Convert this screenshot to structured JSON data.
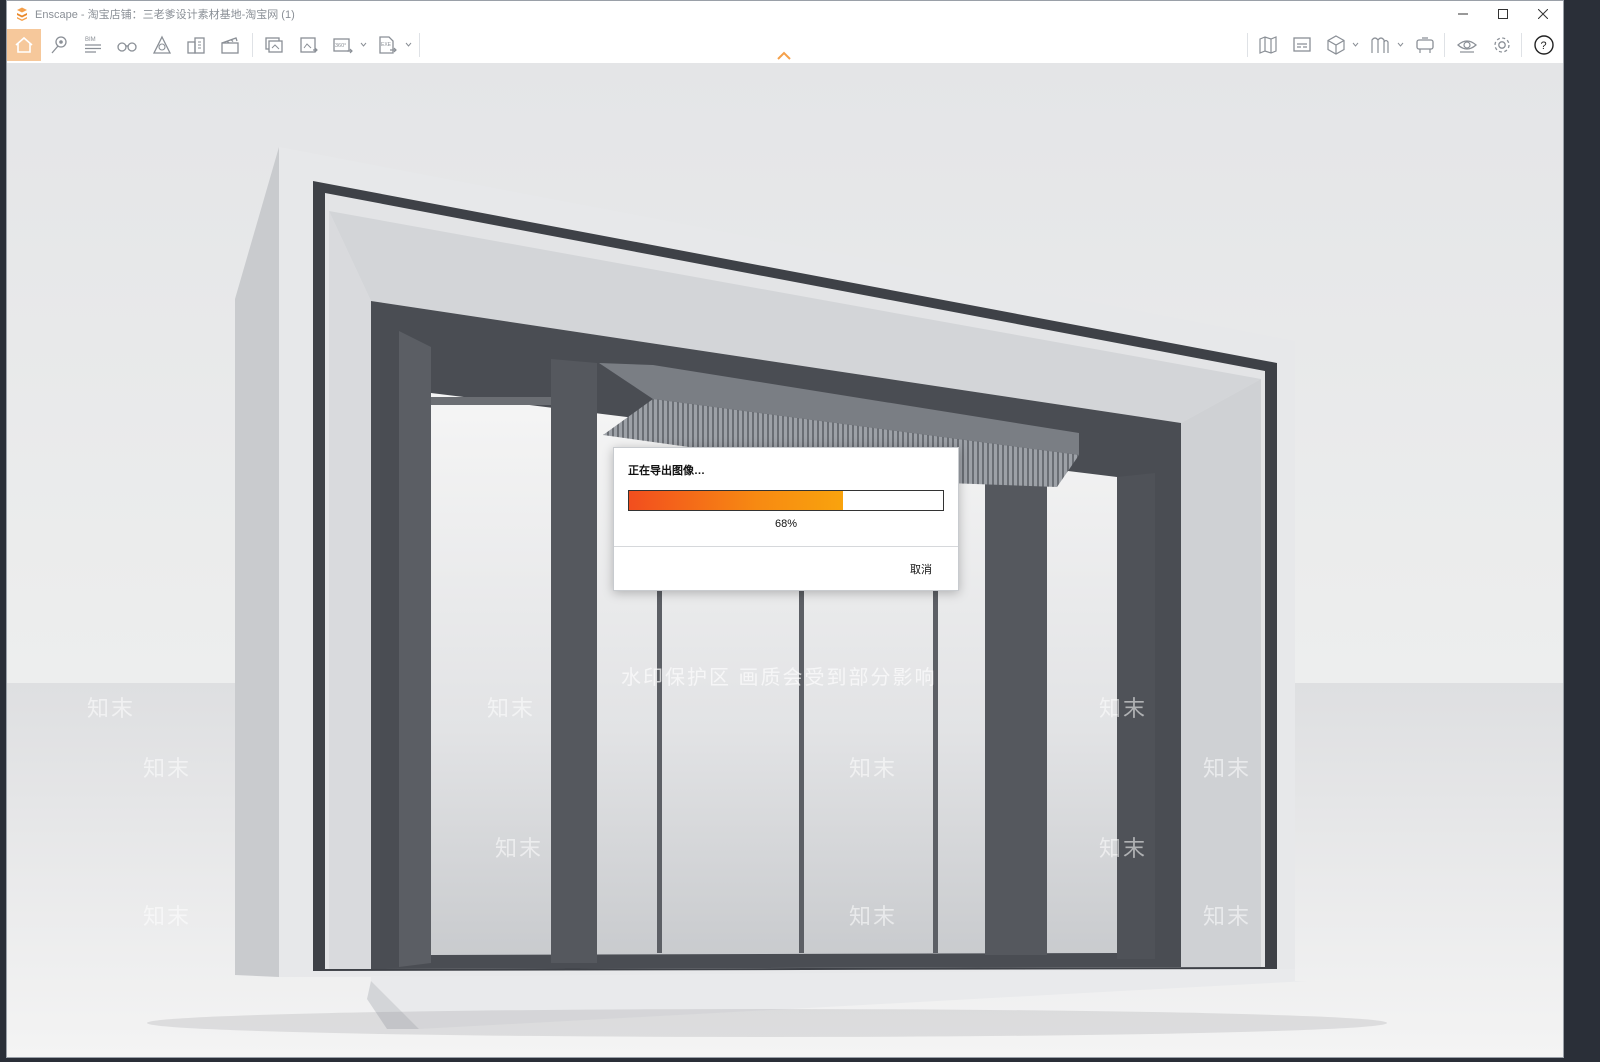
{
  "window": {
    "app_name": "Enscape",
    "title": "Enscape - 淘宝店铺：三老爹设计素材基地-淘宝网 (1)",
    "accent_color": "#f5a04a"
  },
  "toolbar": {
    "left_icons": [
      "home-icon",
      "location-pin-icon",
      "bim-icon",
      "binoculars-icon",
      "perspective-icon",
      "buildings-icon",
      "clapperboard-icon",
      "batch-render-icon",
      "panorama-export-icon",
      "360-panorama-icon",
      "exe-export-icon"
    ],
    "bim_label": "BIM",
    "pano_label": "360°",
    "exe_label": "EXE",
    "right_icons": [
      "map-icon",
      "rendering-icon",
      "cube-icon",
      "asset-library-icon",
      "vr-headset-icon",
      "eye-icon",
      "settings-icon",
      "help-icon"
    ]
  },
  "dialog": {
    "title": "正在导出图像…",
    "progress_percent": 68,
    "progress_text": "68%",
    "cancel_label": "取消"
  },
  "watermark": {
    "banner": "水印保护区  画质会受到部分影响",
    "brand": "知末"
  }
}
